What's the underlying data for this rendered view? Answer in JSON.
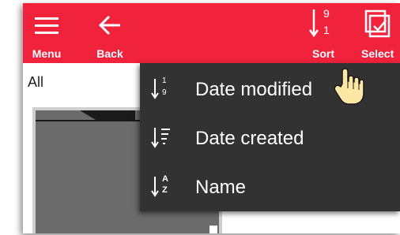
{
  "toolbar": {
    "menu_label": "Menu",
    "back_label": "Back",
    "sort_label": "Sort",
    "sort_icon_top": "9",
    "sort_icon_bottom": "1",
    "select_label": "Select",
    "background_color": "#f0223c"
  },
  "content": {
    "filter_label": "All"
  },
  "sort_menu": {
    "background_color": "#323232",
    "items": [
      {
        "label": "Date modified",
        "icon": "sort-numeric-ascending-icon",
        "icon_top": "1",
        "icon_bottom": "9"
      },
      {
        "label": "Date created",
        "icon": "sort-date-created-icon"
      },
      {
        "label": "Name",
        "icon": "sort-alpha-ascending-icon",
        "icon_top": "A",
        "icon_bottom": "Z"
      }
    ]
  },
  "icons": [
    "hamburger-menu-icon",
    "back-arrow-icon",
    "sort-icon",
    "select-checkbox-icon",
    "folder-icon",
    "hand-cursor-icon"
  ]
}
